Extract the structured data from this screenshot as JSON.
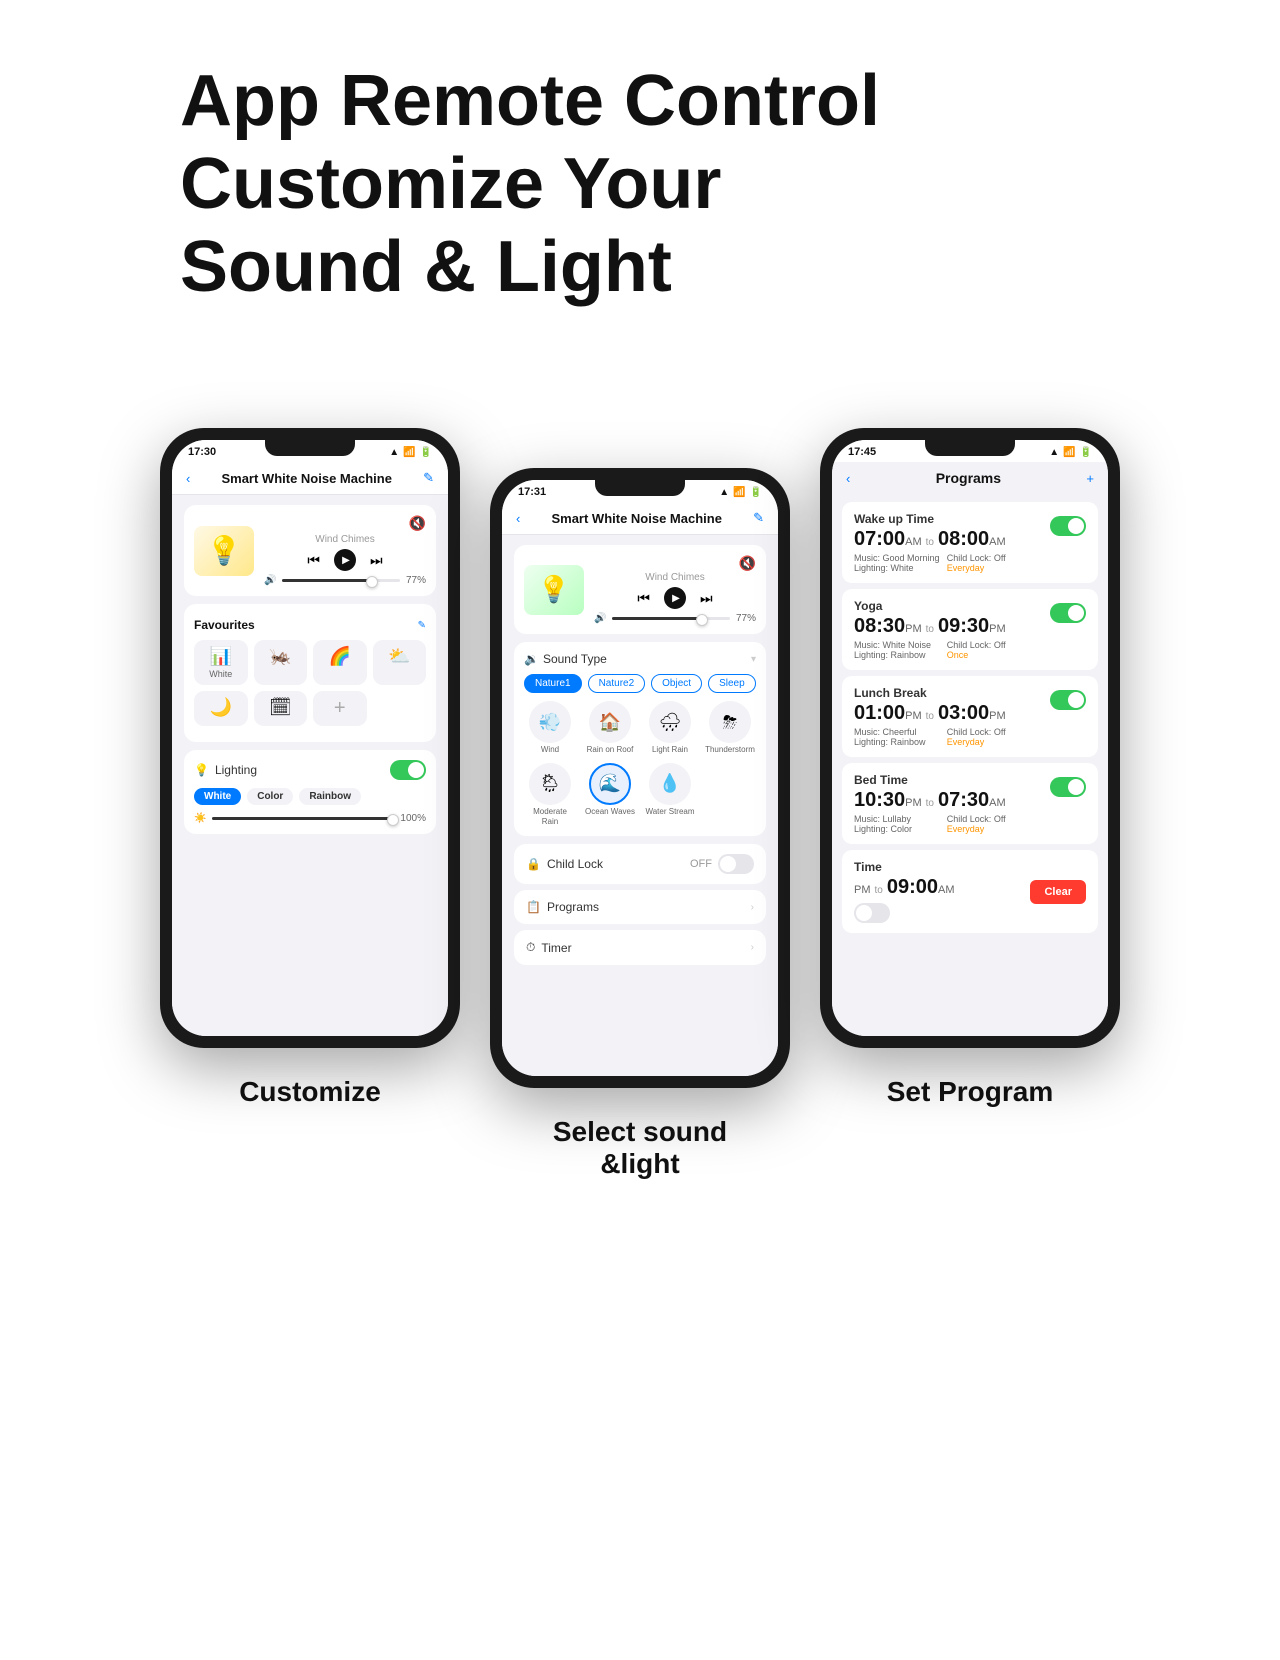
{
  "headline": {
    "line1": "App Remote Control",
    "line2": "Customize Your",
    "line3": "Sound & Light"
  },
  "phone1": {
    "time": "17:30",
    "title": "Smart White Noise Machine",
    "sound_name": "Wind Chimes",
    "volume_pct": "77%",
    "volume_fill": "77%",
    "favourites_label": "Favourites",
    "fav_items": [
      {
        "icon": "🔊",
        "label": "White"
      },
      {
        "icon": "🌿",
        "label": ""
      },
      {
        "icon": "🌈",
        "label": ""
      },
      {
        "icon": "⛈",
        "label": ""
      }
    ],
    "lighting_label": "Lighting",
    "color_options": [
      "White",
      "Color",
      "Rainbow"
    ],
    "active_color": "White",
    "brightness_pct": "100%",
    "caption": "Customize"
  },
  "phone2": {
    "time": "17:31",
    "title": "Smart White Noise Machine",
    "sound_name": "Wind Chimes",
    "volume_pct": "77%",
    "sound_type_label": "Sound Type",
    "tabs": [
      "Nature1",
      "Nature2",
      "Object",
      "Sleep"
    ],
    "active_tab": "Nature1",
    "sounds": [
      {
        "icon": "💨",
        "label": "Wind"
      },
      {
        "icon": "🏠",
        "label": "Rain on Roof"
      },
      {
        "icon": "🌧",
        "label": "Light Rain"
      },
      {
        "icon": "⛈",
        "label": "Thunderstorm"
      },
      {
        "icon": "🌧",
        "label": "Moderate Rain"
      },
      {
        "icon": "🌊",
        "label": "Ocean Waves"
      },
      {
        "icon": "💧",
        "label": "Water Stream"
      }
    ],
    "child_lock_label": "Child Lock",
    "child_lock_state": "OFF",
    "programs_label": "Programs",
    "timer_label": "Timer",
    "caption_line1": "Select sound",
    "caption_line2": "&light"
  },
  "phone3": {
    "time": "17:45",
    "title": "Programs",
    "programs": [
      {
        "name": "Wake up Time",
        "start": "07:00",
        "start_ampm": "AM",
        "end": "08:00",
        "end_ampm": "AM",
        "music": "Good Morning",
        "child_lock": "Off",
        "lighting": "White",
        "freq": "Everyday",
        "enabled": true
      },
      {
        "name": "Yoga",
        "start": "08:30",
        "start_ampm": "PM",
        "end": "09:30",
        "end_ampm": "PM",
        "music": "White Noise",
        "child_lock": "Off",
        "lighting": "Rainbow",
        "freq": "Once",
        "enabled": true
      },
      {
        "name": "Lunch Break",
        "start": "01:00",
        "start_ampm": "PM",
        "end": "03:00",
        "end_ampm": "PM",
        "music": "Cheerful",
        "child_lock": "Off",
        "lighting": "Rainbow",
        "freq": "Everyday",
        "enabled": true
      },
      {
        "name": "Bed Time",
        "start": "10:30",
        "start_ampm": "PM",
        "end": "07:30",
        "end_ampm": "AM",
        "music": "Lullaby",
        "child_lock": "Off",
        "lighting": "Color",
        "freq": "Everyday",
        "enabled": true
      },
      {
        "name": "Time",
        "start": "",
        "start_ampm": "PM",
        "end": "09:00",
        "end_ampm": "AM",
        "music": "",
        "child_lock": "",
        "lighting": "",
        "freq": "",
        "enabled": false,
        "has_clear": true
      }
    ],
    "caption": "Set Program"
  }
}
